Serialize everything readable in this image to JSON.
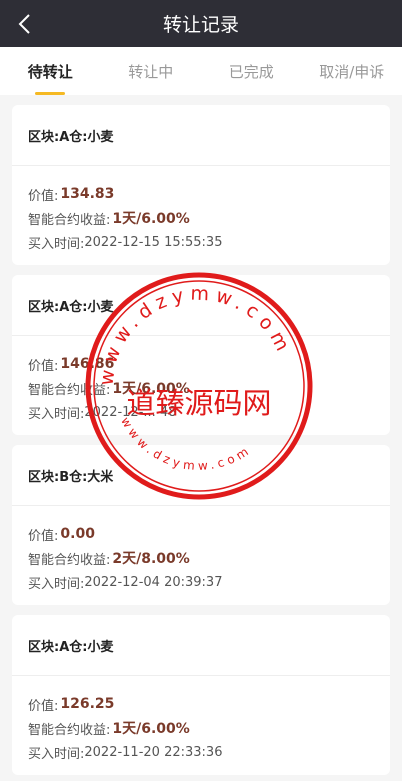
{
  "header": {
    "title": "转让记录"
  },
  "tabs": [
    {
      "label": "待转让"
    },
    {
      "label": "转让中"
    },
    {
      "label": "已完成"
    },
    {
      "label": "取消/申诉"
    }
  ],
  "records": [
    {
      "title": "区块:A仓:小麦",
      "value_label": "价值:",
      "value": "134.83",
      "profit_label": "智能合约收益:",
      "profit": "1天/6.00%",
      "time_label": "买入时间:",
      "time": "2022-12-15 15:55:35"
    },
    {
      "title": "区块:A仓:小麦",
      "value_label": "价值:",
      "value": "146.86",
      "profit_label": "智能合约收益:",
      "profit": "1天/6.00%",
      "time_label": "买入时间:",
      "time": "2022-12-... 48"
    },
    {
      "title": "区块:B仓:大米",
      "value_label": "价值:",
      "value": "0.00",
      "profit_label": "智能合约收益:",
      "profit": "2天/8.00%",
      "time_label": "买入时间:",
      "time": "2022-12-04 20:39:37"
    },
    {
      "title": "区块:A仓:小麦",
      "value_label": "价值:",
      "value": "126.25",
      "profit_label": "智能合约收益:",
      "profit": "1天/6.00%",
      "time_label": "买入时间:",
      "time": "2022-11-20 22:33:36"
    }
  ],
  "watermark": {
    "top_arc": "www.dzymw.com",
    "center": "道臻源码网",
    "bottom_arc": "www.dzymw.com",
    "color": "#e01b1b"
  },
  "colors": {
    "header_bg": "#2e2e36",
    "tab_indicator": "#f5b923",
    "value_color": "#7a3a2a"
  }
}
